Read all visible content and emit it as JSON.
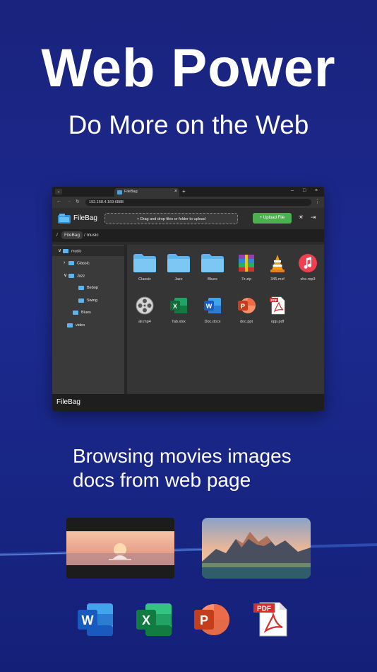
{
  "hero": {
    "title": "Web Power",
    "subtitle": "Do More on the Web"
  },
  "browser": {
    "tab_title": "FileBag",
    "tab_close": "×",
    "new_tab": "+",
    "controls": {
      "minimize": "–",
      "maximize": "□",
      "close": "×"
    },
    "url": "192.168.4.169:6888",
    "nav": {
      "back": "←",
      "forward": "→",
      "reload": "↻",
      "menu": "⋮",
      "tabs": "⌄"
    }
  },
  "app": {
    "brand": "FileBag",
    "drop_zone": "+ Drag and drop files or folder to upload",
    "upload_button": "+ Upload File",
    "theme_icon": "☀",
    "logout_icon": "⇥",
    "breadcrumb": {
      "root": "/",
      "chip": "FileBag",
      "rest": "/ music"
    },
    "tree": [
      {
        "label": "music",
        "caret": "∨"
      },
      {
        "label": "Classic",
        "caret": "›"
      },
      {
        "label": "Jazz",
        "caret": "∨"
      },
      {
        "label": "Bebop",
        "caret": ""
      },
      {
        "label": "Swing",
        "caret": ""
      },
      {
        "label": "Blues",
        "caret": ""
      },
      {
        "label": "video",
        "caret": ""
      }
    ],
    "files": [
      {
        "name": "Classic",
        "icon": "folder-icon"
      },
      {
        "name": "Jazz",
        "icon": "folder-icon"
      },
      {
        "name": "Blues",
        "icon": "folder-icon"
      },
      {
        "name": "7z.zip",
        "icon": "archive-icon"
      },
      {
        "name": "345.mxf",
        "icon": "vlc-cone-icon"
      },
      {
        "name": "she.mp3",
        "icon": "music-note-icon"
      },
      {
        "name": "all.mp4",
        "icon": "film-reel-icon"
      },
      {
        "name": "Tab.xlsx",
        "icon": "excel-icon"
      },
      {
        "name": "Doc.docx",
        "icon": "word-icon"
      },
      {
        "name": "doc.ppt",
        "icon": "powerpoint-icon"
      },
      {
        "name": "opp.pdf",
        "icon": "pdf-icon"
      }
    ],
    "footer": "FileBag"
  },
  "caption": {
    "line1": "Browsing movies images",
    "line2": "docs from web page"
  },
  "doc_icons": {
    "word": "W",
    "excel": "X",
    "powerpoint": "P",
    "pdf": "PDF"
  },
  "colors": {
    "background": "#1a237e",
    "upload_green": "#4caf50",
    "folder_blue": "#5eb4ee"
  }
}
